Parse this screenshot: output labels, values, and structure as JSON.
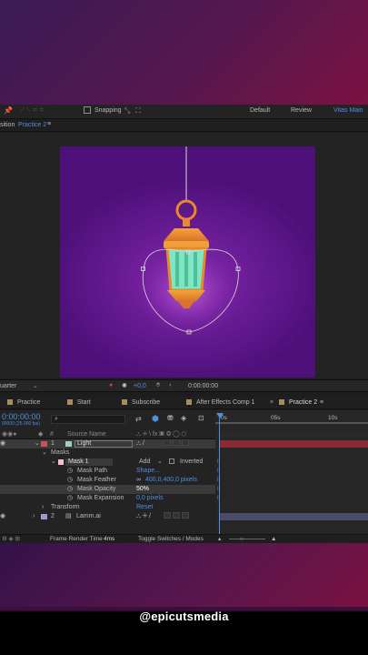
{
  "toolbar": {
    "snapping_label": "Snapping",
    "workspaces": [
      "Default",
      "Review",
      "Vitas Main"
    ]
  },
  "composition": {
    "tab_prefix": "sition",
    "name": "Practice 2",
    "menu_glyph": "≡"
  },
  "viewer_bar": {
    "resolution": "uarter",
    "exposure": "+0,0",
    "timecode": "0:00:00:00"
  },
  "timeline_tabs": [
    "Practice",
    "Start",
    "Subscribe",
    "After Effects Comp 1",
    "Practice 2"
  ],
  "timeline_tabs_close": "×",
  "timeline": {
    "current_time": "0:00:00:00",
    "fps_info": "00000 (25.000 fps)",
    "search_placeholder": "",
    "ruler_labels": [
      "0s",
      "05s",
      "10s"
    ],
    "column_hash": "#",
    "column_source": "Source Name",
    "layers": [
      {
        "num": "1",
        "name": "Light",
        "color": "#c7525d"
      },
      {
        "num": "2",
        "name": "Lamm.ai",
        "color": "#9a9ad6"
      }
    ],
    "masks_label": "Masks",
    "mask_name": "Mask 1",
    "mask_mode": "Add",
    "mask_inverted": "Inverted",
    "mask_props": [
      {
        "name": "Mask Path",
        "value": "Shape..."
      },
      {
        "name": "Mask Feather",
        "value": "400,0,400,0 pixels"
      },
      {
        "name": "Mask Opacity",
        "value": "50%"
      },
      {
        "name": "Mask Expansion",
        "value": "0,0 pixels"
      }
    ],
    "transform_label": "Transform",
    "transform_value": "Reset"
  },
  "status": {
    "render_label": "Frame Render Time",
    "render_value": "4ms",
    "toggle_label": "Toggle Switches / Modes"
  },
  "watermark": "@epicutsmedia",
  "colors": {
    "accent_blue": "#4f8fe0",
    "canvas_purple": "#6a1c96",
    "lantern_orange": "#e8892a",
    "lantern_glass": "#7ee6c2",
    "layer_red": "#8a2a34"
  }
}
